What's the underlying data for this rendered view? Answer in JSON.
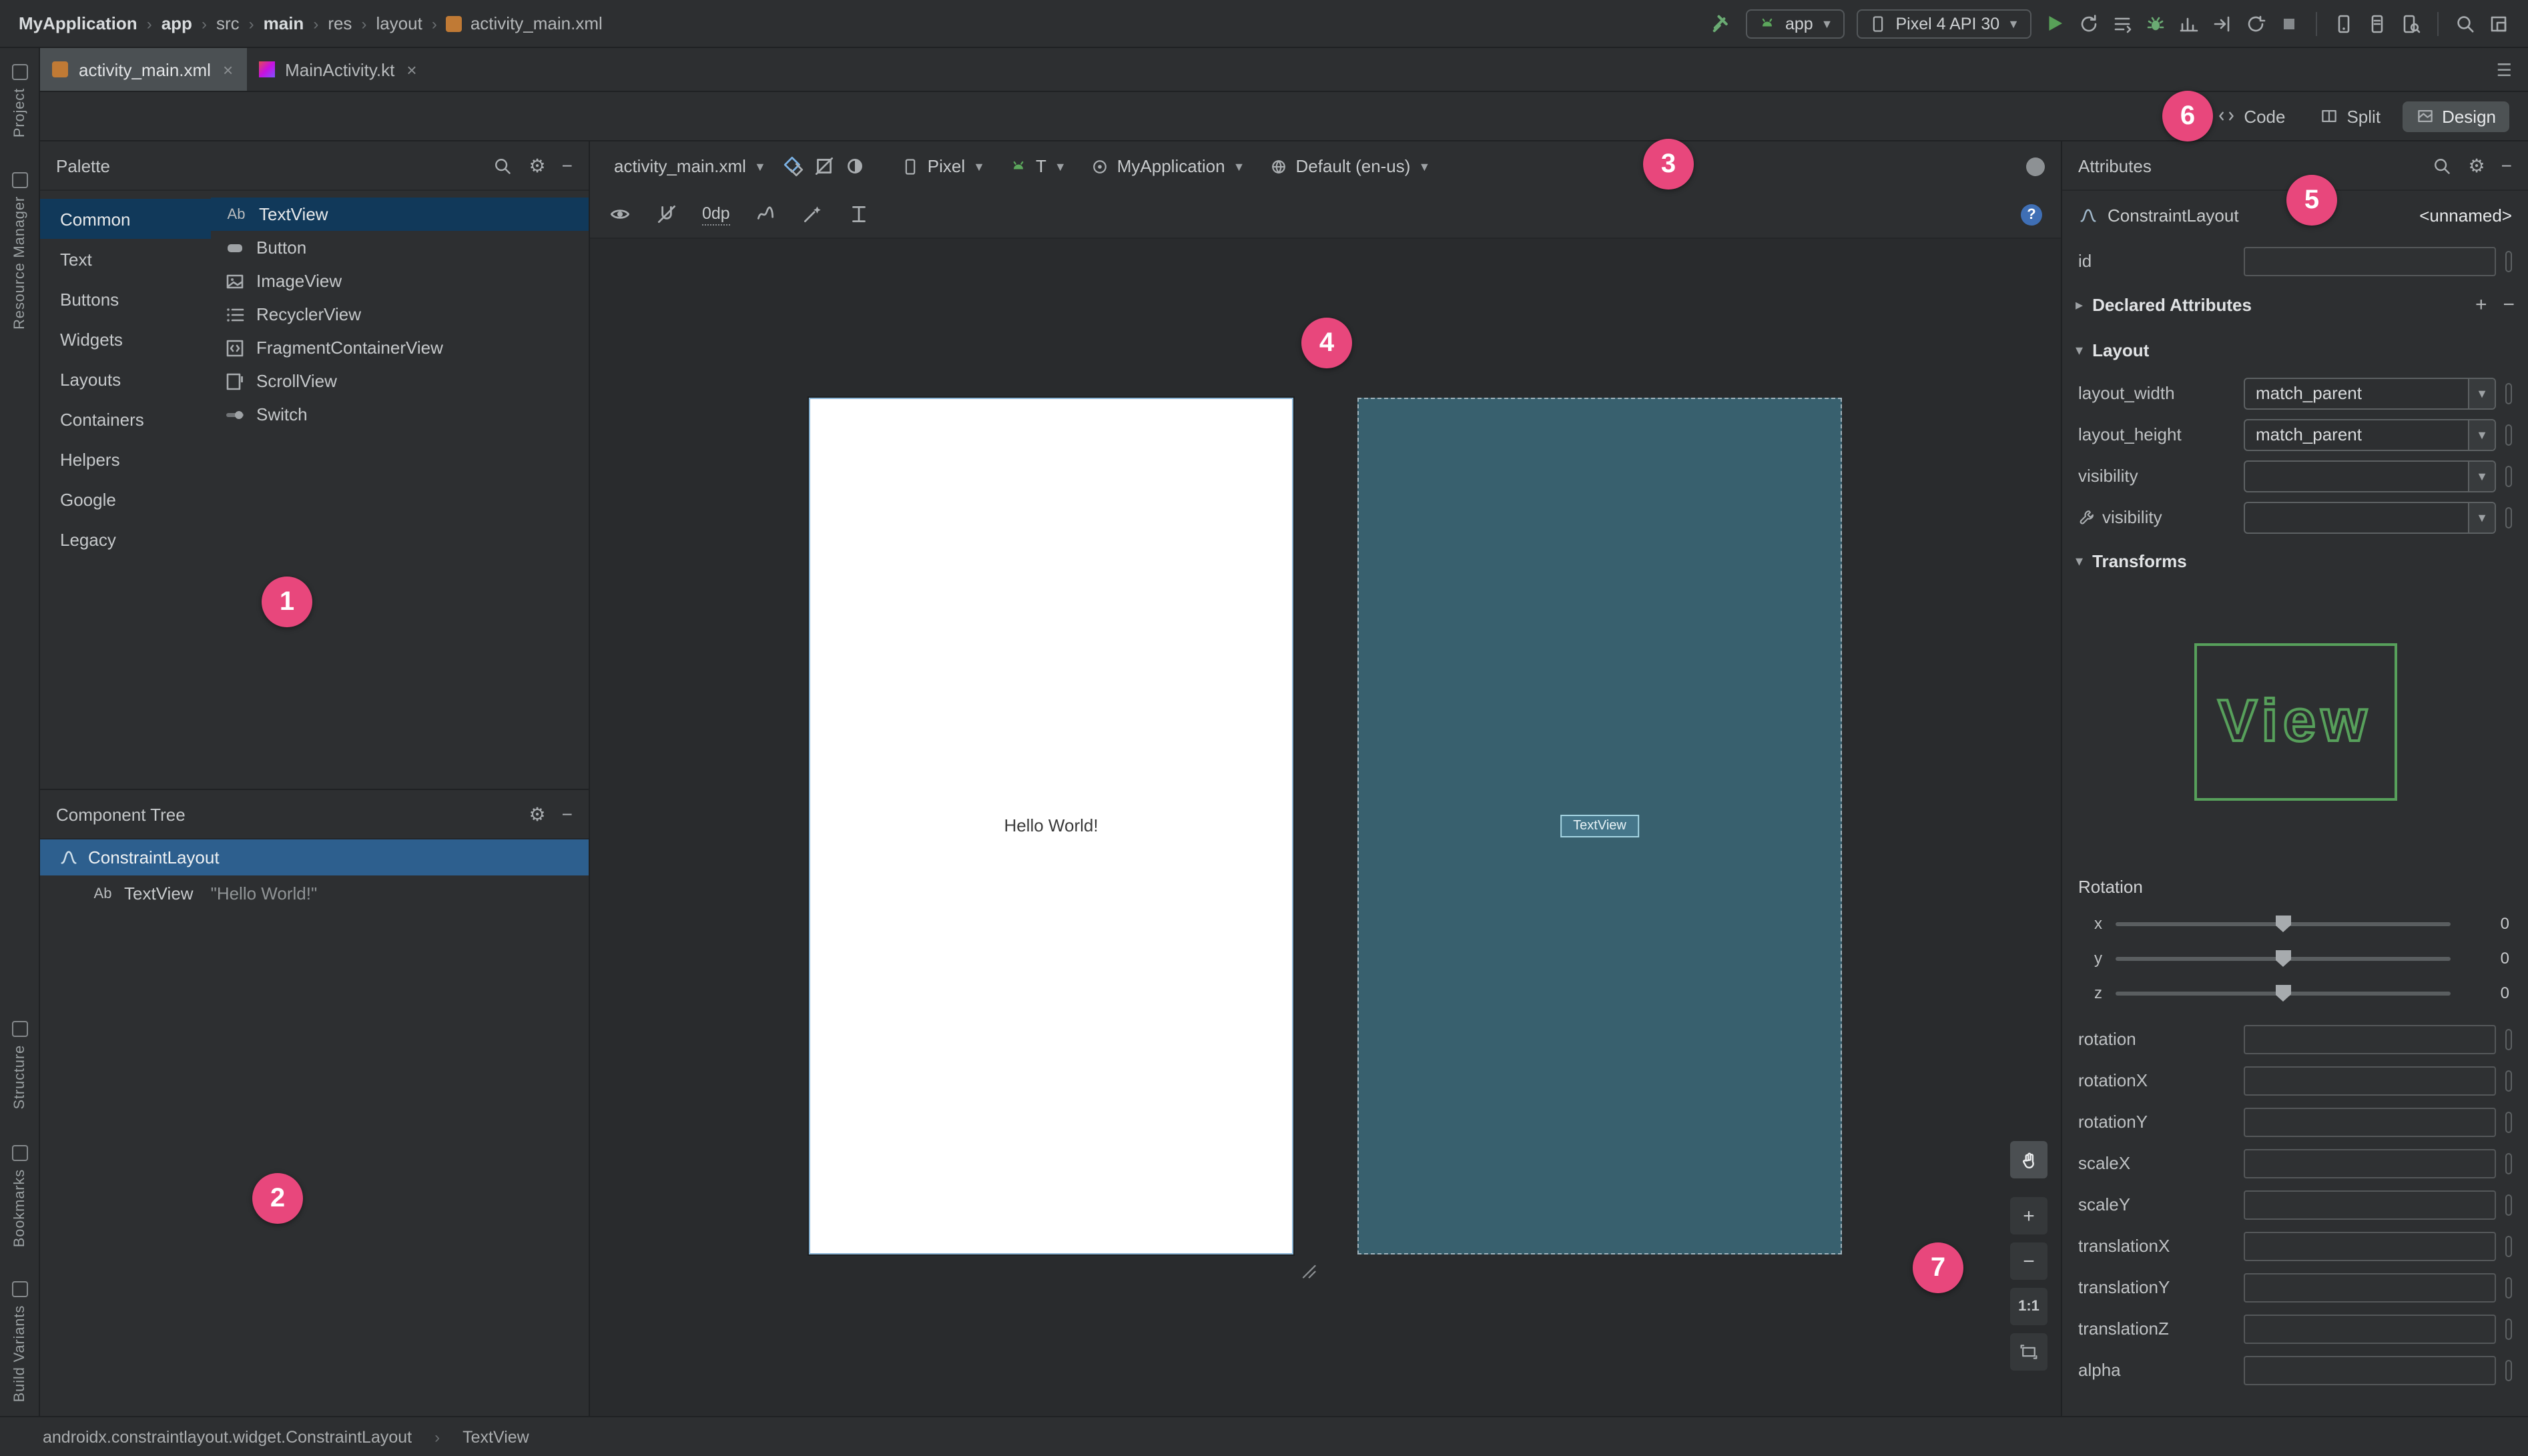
{
  "colors": {
    "accent_pink": "#e8477c",
    "tree_selection": "#2d5f8e",
    "palette_selection": "#11395a",
    "blueprint_bg": "#38606e",
    "run_green": "#58a158",
    "view_outline_green": "#57a05b"
  },
  "topbar": {
    "breadcrumb": [
      "MyApplication",
      "app",
      "src",
      "main",
      "res",
      "layout",
      "activity_main.xml"
    ],
    "run_config": "app",
    "device": "Pixel 4 API 30"
  },
  "tabs": [
    {
      "label": "activity_main.xml"
    },
    {
      "label": "MainActivity.kt"
    }
  ],
  "view_toggle": {
    "code": "Code",
    "split": "Split",
    "design": "Design"
  },
  "stripe": {
    "top": [
      "Project",
      "Resource Manager"
    ],
    "bottom": [
      "Structure",
      "Bookmarks",
      "Build Variants"
    ]
  },
  "palette": {
    "title": "Palette",
    "categories": [
      "Common",
      "Text",
      "Buttons",
      "Widgets",
      "Layouts",
      "Containers",
      "Helpers",
      "Google",
      "Legacy"
    ],
    "items": [
      "TextView",
      "Button",
      "ImageView",
      "RecyclerView",
      "FragmentContainerView",
      "ScrollView",
      "Switch"
    ]
  },
  "component_tree": {
    "title": "Component Tree",
    "root": "ConstraintLayout",
    "child": "TextView",
    "child_text": "\"Hello World!\""
  },
  "design_toolbar": {
    "file": "activity_main.xml",
    "margin": "0dp",
    "device": "Pixel",
    "api": "T",
    "theme": "MyApplication",
    "locale": "Default (en-us)",
    "help": "?"
  },
  "canvas": {
    "hello": "Hello World!",
    "chip": "TextView",
    "zoom_in": "+",
    "zoom_out": "−",
    "zoom_reset": "1:1"
  },
  "attributes": {
    "title": "Attributes",
    "component": "ConstraintLayout",
    "component_id": "<unnamed>",
    "id_label": "id",
    "declared_label": "Declared Attributes",
    "layout_label": "Layout",
    "rows": [
      {
        "label": "layout_width",
        "value": "match_parent"
      },
      {
        "label": "layout_height",
        "value": "match_parent"
      },
      {
        "label": "visibility",
        "value": ""
      },
      {
        "label": "visibility",
        "value": ""
      }
    ],
    "transforms_label": "Transforms",
    "view_text": "View",
    "rotation_label": "Rotation",
    "sliders": [
      {
        "axis": "x",
        "value": "0"
      },
      {
        "axis": "y",
        "value": "0"
      },
      {
        "axis": "z",
        "value": "0"
      }
    ],
    "fields": [
      "rotation",
      "rotationX",
      "rotationY",
      "scaleX",
      "scaleY",
      "translationX",
      "translationY",
      "translationZ",
      "alpha"
    ]
  },
  "status_bar": {
    "left": "androidx.constraintlayout.widget.ConstraintLayout",
    "right": "TextView"
  },
  "badges": [
    "1",
    "2",
    "3",
    "4",
    "5",
    "6",
    "7"
  ]
}
